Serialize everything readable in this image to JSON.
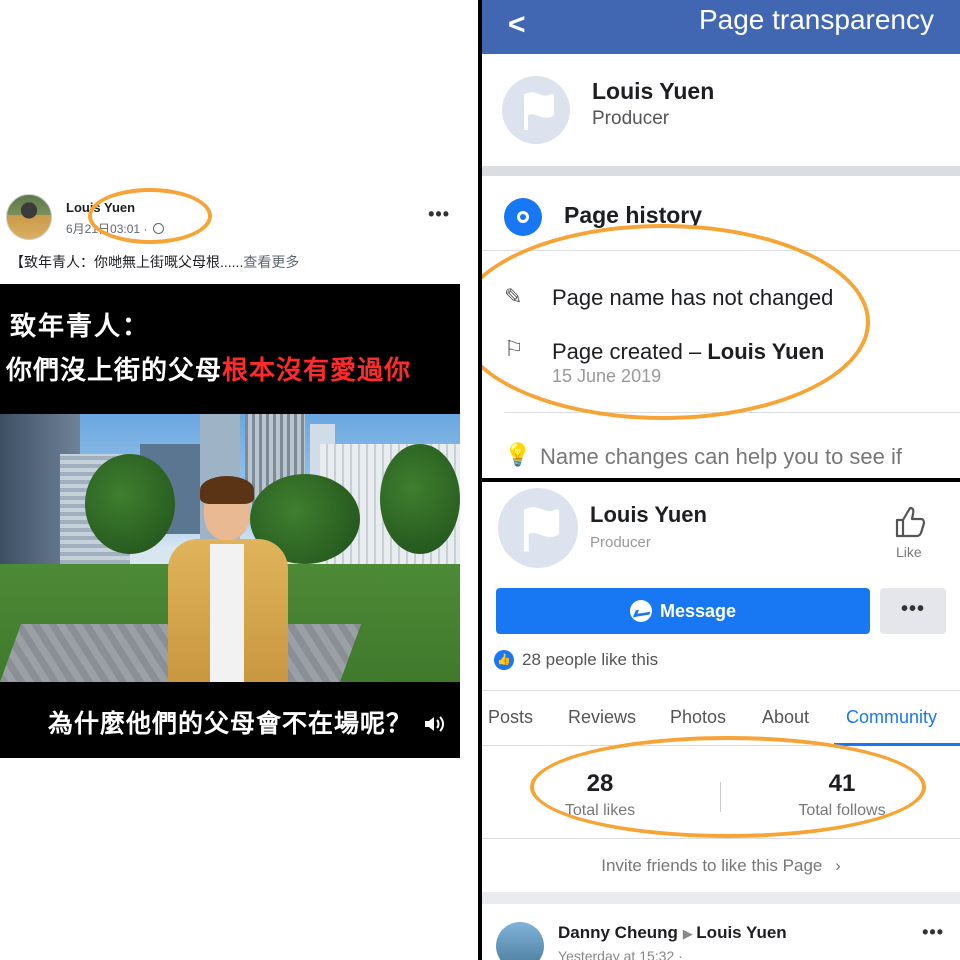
{
  "left": {
    "author": "Louis Yuen",
    "time": "6月21日03:01 ·",
    "more": "•••",
    "post_text": "【致年青人：你哋無上街嘅父母根......",
    "see_more": "查看更多",
    "video": {
      "line1": "致年青人：",
      "line2_white": "你們沒上街的父母",
      "line2_red": "根本沒有愛過你",
      "caption": "為什麼他們的父母會不在場呢？"
    }
  },
  "transparency": {
    "title": "Page transparency",
    "back": "<",
    "page_name": "Louis Yuen",
    "page_role": "Producer",
    "section_title": "Page history",
    "items": [
      {
        "text": "Page name has not changed"
      },
      {
        "text_prefix": "Page created – ",
        "text_bold": "Louis Yuen",
        "date": "15 June 2019"
      }
    ],
    "hint": "Name changes can help you to see if"
  },
  "page": {
    "name": "Louis Yuen",
    "role": "Producer",
    "like_label": "Like",
    "message_label": "Message",
    "more": "•••",
    "likes_line": "28 people like this",
    "tabs": [
      "Posts",
      "Reviews",
      "Photos",
      "About",
      "Community"
    ],
    "active_tab": "Community",
    "stats": [
      {
        "value": "28",
        "label": "Total likes"
      },
      {
        "value": "41",
        "label": "Total follows"
      }
    ],
    "invite": "Invite friends to like this Page",
    "feed": {
      "from": "Danny Cheung",
      "to": "Louis Yuen",
      "time": "Yesterday at 15:32 ·",
      "more": "•••"
    }
  },
  "colors": {
    "facebook_blue": "#4267b2",
    "button_blue": "#1877f2",
    "annotation_orange": "#f7a436",
    "video_red": "#ff2a2a"
  }
}
